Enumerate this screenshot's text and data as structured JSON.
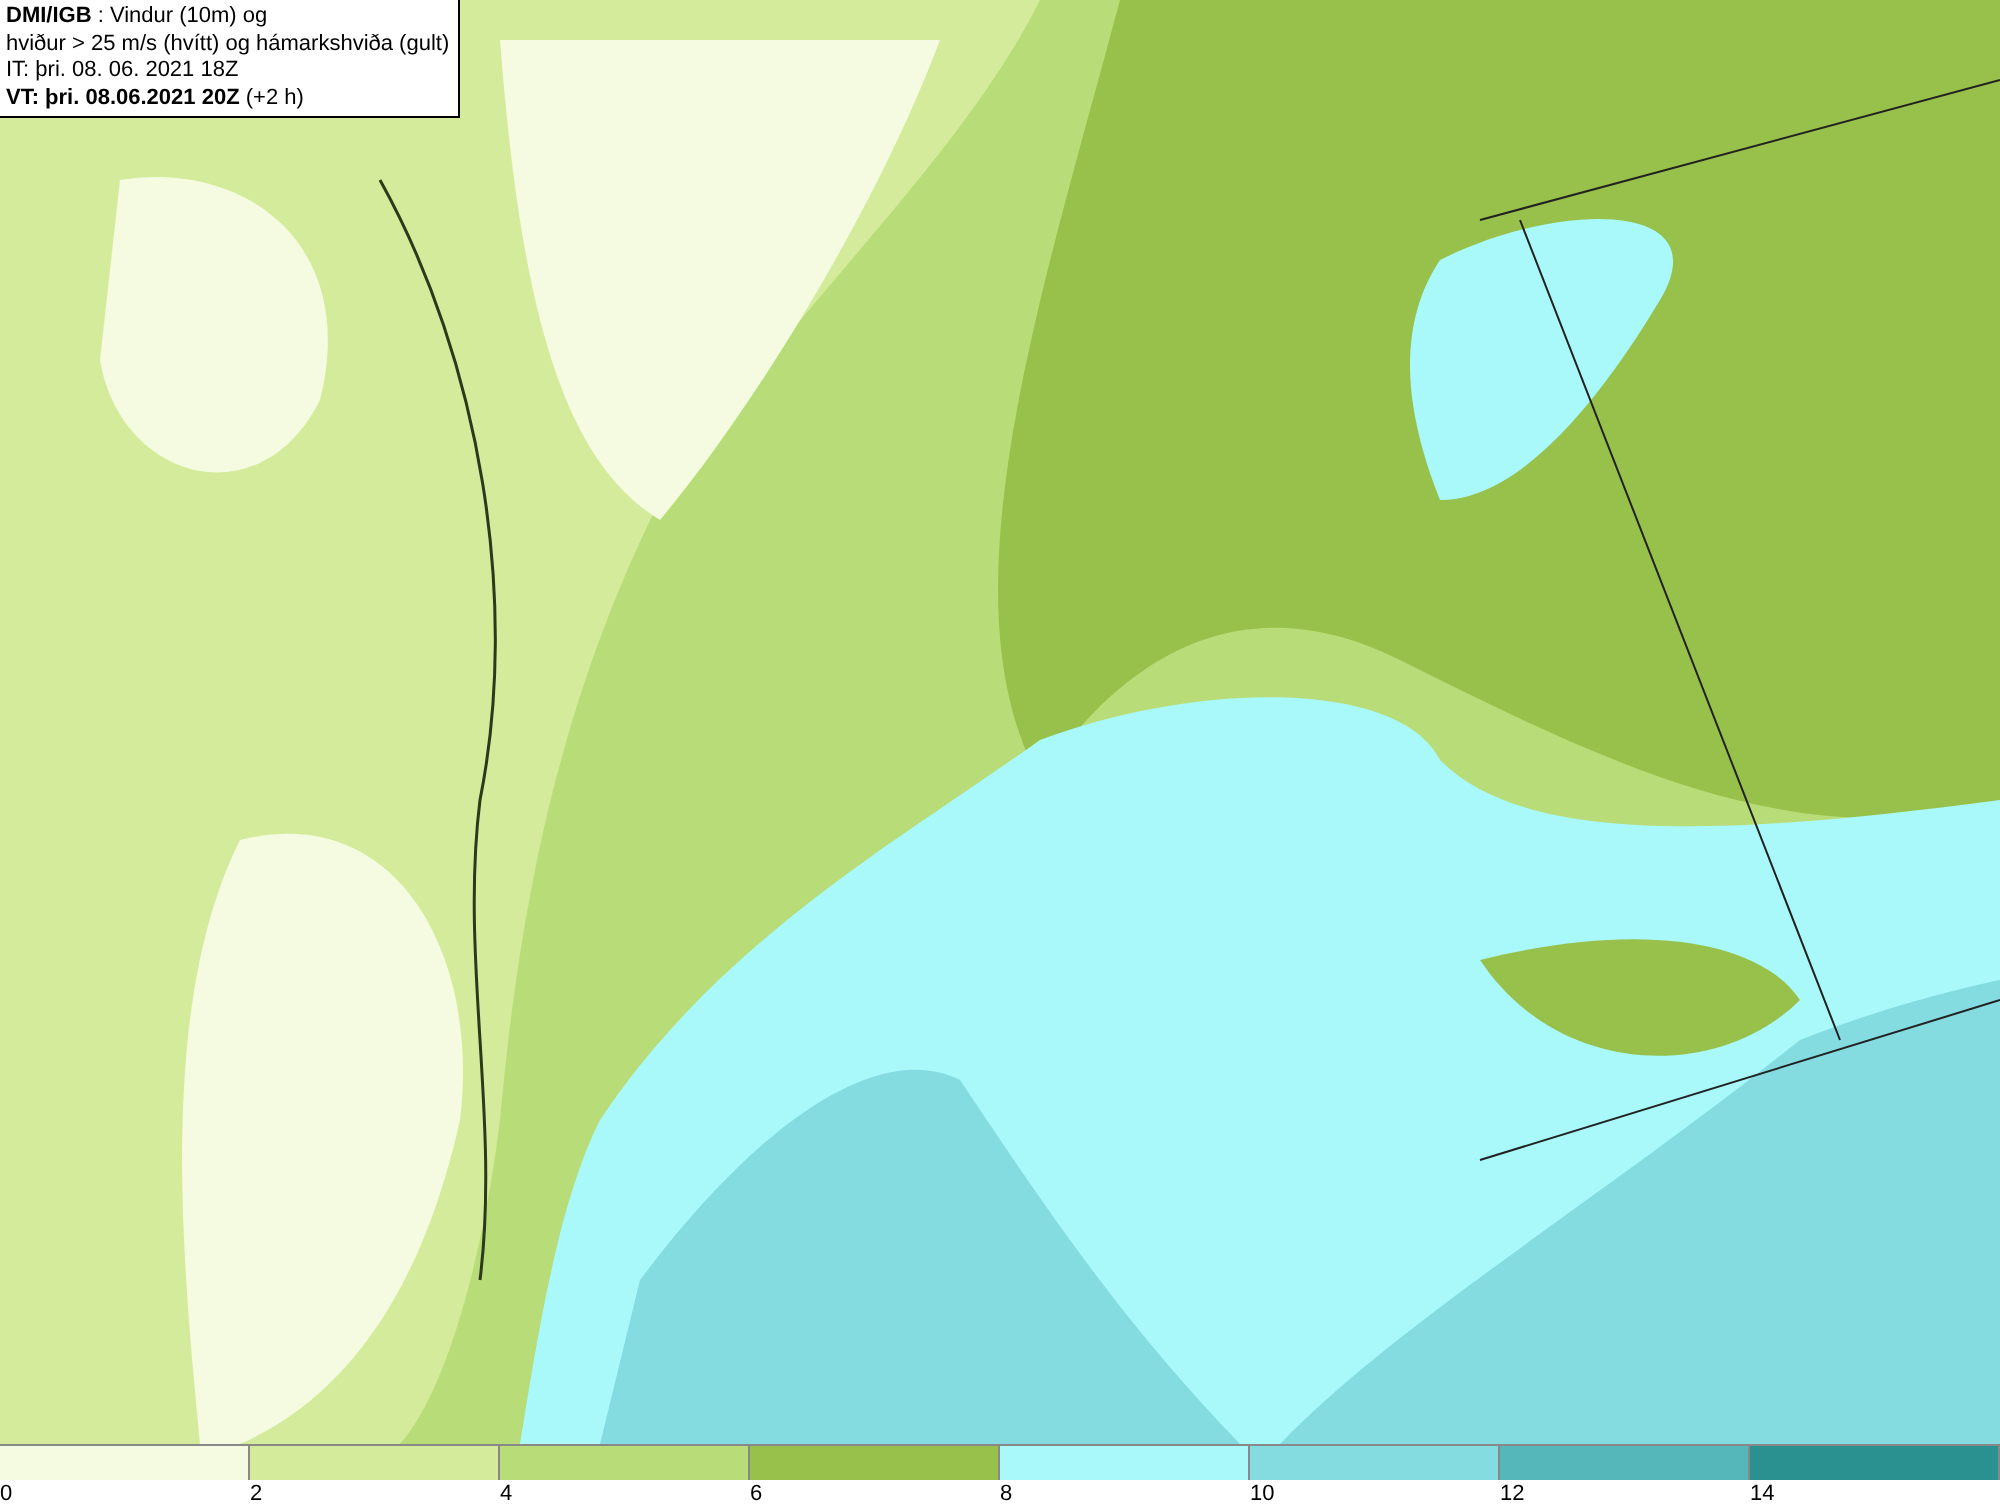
{
  "header": {
    "lines": [
      "**DMI/IGB** : Vindur (10m) og",
      "hviður > 25 m/s (hvítt) og hámarkshviða (gult)",
      "IT: þri. 08. 06. 2021 18Z",
      "**VT: þri. 08.06.2021 20Z** (+2 h)"
    ]
  },
  "legend": [
    {
      "label": "0",
      "color": "#f5fbe0"
    },
    {
      "label": "2",
      "color": "#d4eb9c"
    },
    {
      "label": "4",
      "color": "#b8dc78"
    },
    {
      "label": "6",
      "color": "#97c14a"
    },
    {
      "label": "8",
      "color": "#a9f9fb"
    },
    {
      "label": "10",
      "color": "#84dbe0"
    },
    {
      "label": "12",
      "color": "#55b7b9"
    },
    {
      "label": "14",
      "color": "#2a9190"
    }
  ]
}
